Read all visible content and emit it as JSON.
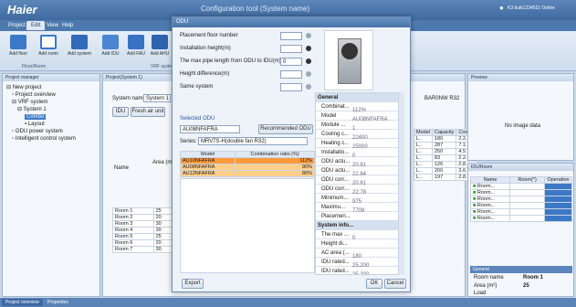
{
  "app": {
    "logo": "Haier",
    "title": "Configuration tool (System name)",
    "account": "K3 bulk1234521 Online"
  },
  "menu": [
    "Project",
    "Edit",
    "View",
    "Help"
  ],
  "ribbon": {
    "buttons": [
      "Add floor",
      "Add room",
      "Add system",
      "Add IDU",
      "Add FAU",
      "Add AHU"
    ],
    "group1": "Floor/Room",
    "group2": "VRF system"
  },
  "project": {
    "header": "Project manager",
    "tree": [
      "New project",
      "Project overview",
      "VRF system",
      "System 1",
      "Combo",
      "Layout",
      "ODU power system",
      "Intelligent control system"
    ]
  },
  "system_panel": {
    "tab": "Project(System 1)",
    "sys_label": "System name:",
    "sys_value": "System 1",
    "sub_tab1": "IDU",
    "sub_tab2": "Fresh air unit",
    "col_name": "Name",
    "col_area": "Area (m²)",
    "rows": [
      [
        "Room 1",
        "25"
      ],
      [
        "Room 2",
        "20"
      ],
      [
        "Room 3",
        "30"
      ],
      [
        "Room 4",
        "30"
      ],
      [
        "Room 5",
        "25"
      ],
      [
        "Room 6",
        "20"
      ],
      [
        "Room 7",
        "30"
      ]
    ],
    "right_header": "Series",
    "right_val": "BAR0NW R32",
    "right_cols": [
      "Model",
      "Capacity",
      "Cooling"
    ],
    "right_rows": [
      [
        "L..",
        "180",
        "2.2..",
        "1.."
      ],
      [
        "L..",
        "287",
        "7.1..",
        "4.."
      ],
      [
        "L..",
        "250",
        "4.5..",
        "3.."
      ],
      [
        "L..",
        "83",
        "2.2..",
        "1.."
      ],
      [
        "L..",
        "126",
        "2.8..",
        "1.."
      ],
      [
        "L..",
        "200",
        "3.6..",
        "1.."
      ],
      [
        "L..",
        "197",
        "2.8..",
        "1.."
      ]
    ]
  },
  "dialog": {
    "title": "ODU",
    "fields": [
      {
        "label": "Placement floor number",
        "value": ""
      },
      {
        "label": "Installation height(m)",
        "value": ""
      },
      {
        "label": "The max pipe length from ODU to IDU(m)",
        "value": "0"
      },
      {
        "label": "Height difference(m)",
        "value": ""
      },
      {
        "label": "Same system",
        "value": ""
      }
    ],
    "selected_odu_label": "Selected ODU",
    "selected_odu": "AU08NFAFRA",
    "recommended_btn": "Recommended ODU",
    "series_label": "Series:",
    "series_value": "MRV7S-H(double fan R32)",
    "table_headers": [
      "Model",
      "Combination ratio (%)"
    ],
    "table_rows": [
      [
        "AU10NFAFRA",
        "112%"
      ],
      [
        "AU08NFAFRA",
        "90%"
      ],
      [
        "AU12NFAFRA",
        "80%"
      ]
    ],
    "export_btn": "Export",
    "ok_btn": "OK",
    "cancel_btn": "Cancel",
    "props": [
      {
        "cat": true,
        "k": "General"
      },
      {
        "k": "Combinat...",
        "v": "112%"
      },
      {
        "k": "Model",
        "v": "AU08NFAFRA"
      },
      {
        "k": "Module ...",
        "v": "1"
      },
      {
        "k": "Cooling c...",
        "v": "22400"
      },
      {
        "k": "Heating c...",
        "v": "25000"
      },
      {
        "k": "Installatio...",
        "v": "0"
      },
      {
        "k": "ODU actu...",
        "v": "20.81"
      },
      {
        "k": "ODU actu...",
        "v": "22.84"
      },
      {
        "k": "ODU corr...",
        "v": "20.81"
      },
      {
        "k": "ODU corr...",
        "v": "22.78"
      },
      {
        "k": "Minimum...",
        "v": "975"
      },
      {
        "k": "Maximu...",
        "v": "7709"
      },
      {
        "k": "Placemen...",
        "v": ""
      },
      {
        "cat": true,
        "k": "System info..."
      },
      {
        "k": "The max ...",
        "v": "0"
      },
      {
        "k": "Height di...",
        "v": ""
      },
      {
        "k": "AC area (...",
        "v": "180"
      },
      {
        "k": "IDU rated...",
        "v": "25.200"
      },
      {
        "k": "IDU rated...",
        "v": "25.200"
      },
      {
        "cat": true,
        "k": "Refrigerant"
      },
      {
        "k": "Refrigera...",
        "v": "8"
      },
      {
        "k": "Total fact...",
        "v": "8.3"
      }
    ]
  },
  "preview": {
    "header": "Preview",
    "text": "No image data"
  },
  "attributes": {
    "header": "IDU/Room",
    "col1": "Name",
    "col2": "Room(*)",
    "col3": "Operation",
    "rows": [
      "Room...",
      "Room...",
      "Room...",
      "Room...",
      "Room...",
      "Room..."
    ],
    "sub_header": "General",
    "room_name_label": "Room name",
    "room_name": "Room 1",
    "area_label": "Area (m²)",
    "area": "25",
    "load_label": "Load"
  },
  "bottom_tabs": [
    "Project overview",
    "Properties"
  ],
  "colors": {
    "accent": "#4772a8",
    "selected": "#ffcf8a",
    "selected_dark": "#ff9a3c"
  }
}
